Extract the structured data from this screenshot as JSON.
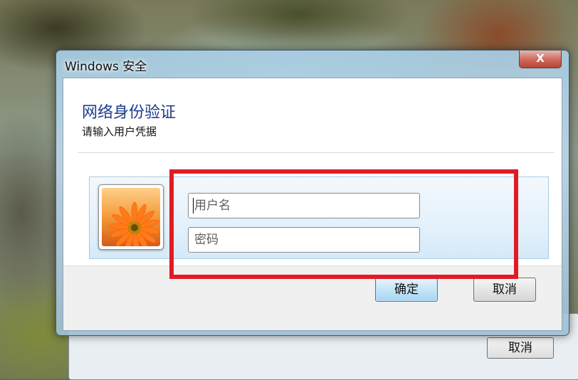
{
  "dialog": {
    "title": "Windows 安全",
    "close_glyph": "X",
    "heading": "网络身份验证",
    "subheading": "请输入用户凭据",
    "username_placeholder": "用户名",
    "password_placeholder": "密码",
    "ok_label": "确定",
    "cancel_label": "取消"
  },
  "background_window": {
    "cancel_label": "取消"
  },
  "colors": {
    "heading": "#1e3a8c",
    "annotation_box": "#e01b24",
    "close_button": "#c9584a"
  },
  "icons": {
    "user_tile": "flower-avatar-icon",
    "close": "close-icon"
  }
}
